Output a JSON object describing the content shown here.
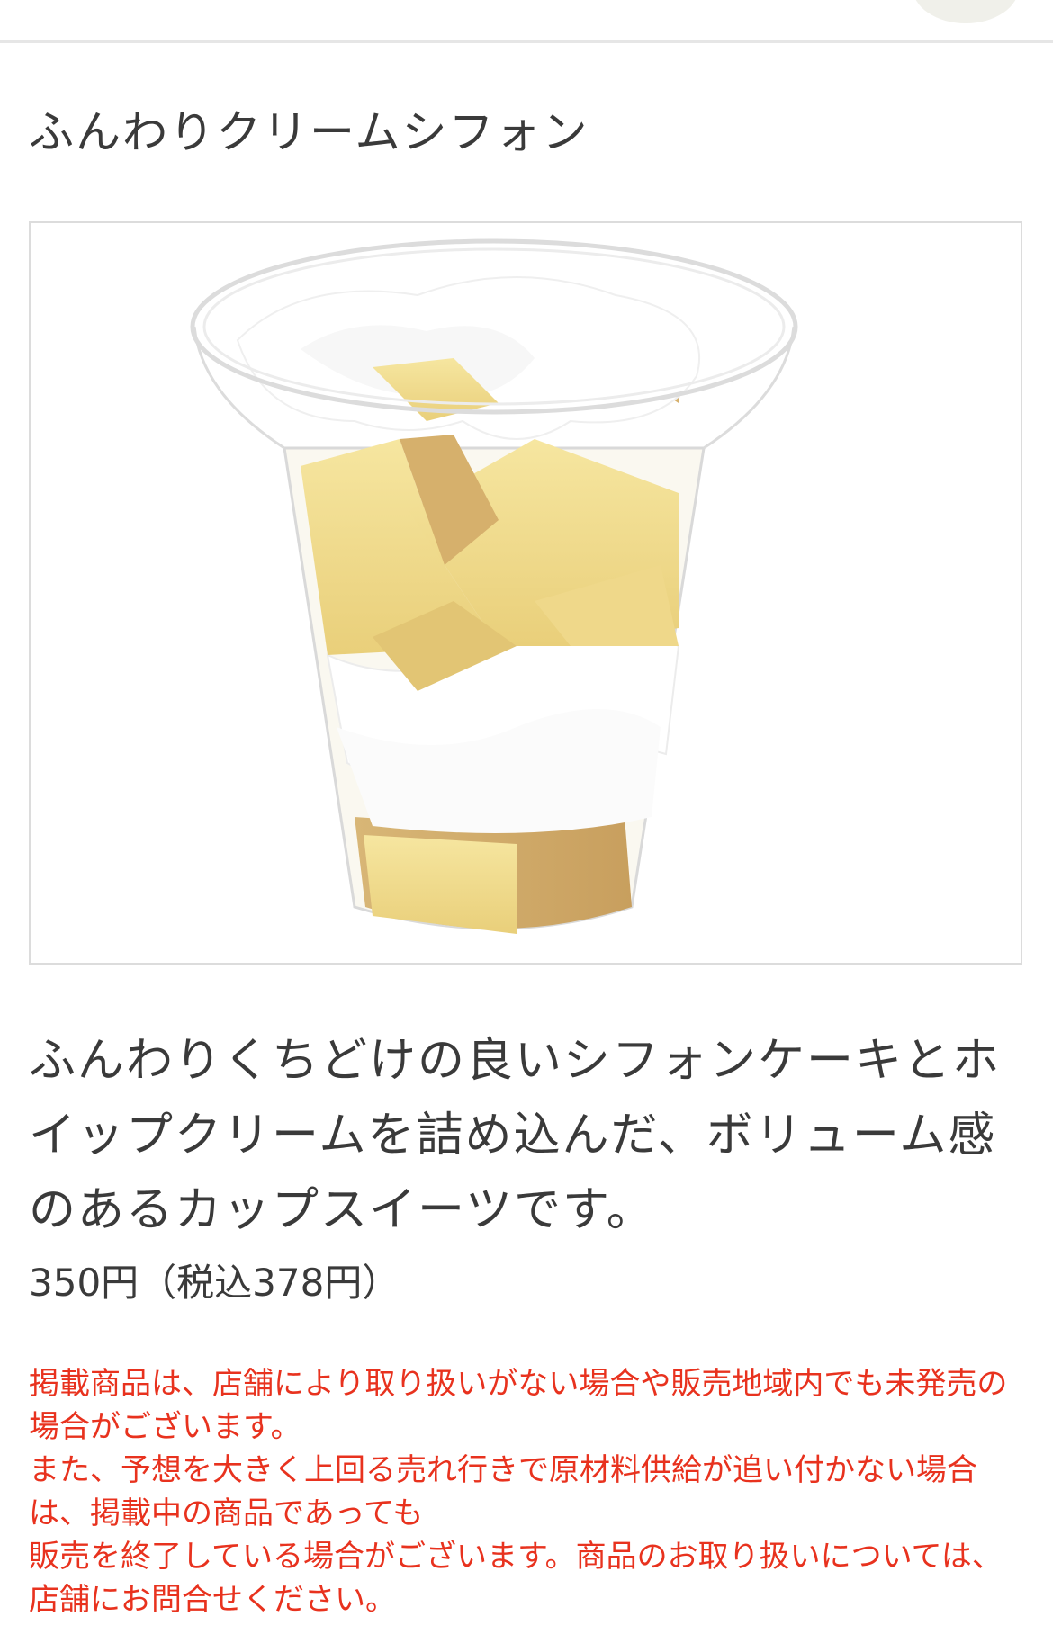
{
  "product": {
    "name": "ふんわりクリームシフォン",
    "image_alt": "ふんわりクリームシフォン",
    "description": "ふんわりくちどけの良いシフォンケーキとホイップクリームを詰め込んだ、ボリューム感のあるカップスイーツです。",
    "price": "350円（税込378円）"
  },
  "notice": {
    "line1": "掲載商品は、店舗により取り扱いがない場合や販売地域内でも未発売の場合がございます。",
    "line2": "また、予想を大きく上回る売れ行きで原材料供給が追い付かない場合は、掲載中の商品であっても",
    "line3": "販売を終了している場合がございます。商品のお取り扱いについては、店舗にお問合せください。"
  },
  "colors": {
    "notice_text": "#e8321e",
    "body_text": "#3a3a3a",
    "divider": "#e6e6e6"
  }
}
